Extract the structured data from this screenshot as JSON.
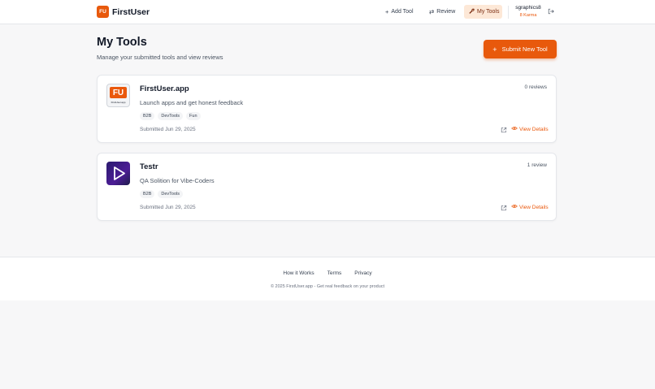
{
  "header": {
    "logo_text": "FU",
    "brand": "FirstUser",
    "nav": {
      "add_tool": "Add Tool",
      "review": "Review",
      "my_tools": "My Tools"
    },
    "user": {
      "name": "sgraphics8",
      "karma": "8 Karma"
    }
  },
  "page": {
    "title": "My Tools",
    "subtitle": "Manage your submitted tools and view reviews",
    "submit_button": "Submit New Tool"
  },
  "tools": [
    {
      "name": "FirstUser.app",
      "description": "Launch apps and get honest feedback",
      "tags": [
        "B2B",
        "DevTools",
        "Fun"
      ],
      "submitted": "Submitted Jun 29, 2025",
      "reviews": "0 reviews",
      "view_details": "View Details",
      "thumb_mark": "FU",
      "thumb_caption": "FirstUser.app"
    },
    {
      "name": "Testr",
      "description": "QA Solition for Vibe-Coders",
      "tags": [
        "B2B",
        "DevTools"
      ],
      "submitted": "Submitted Jun 29, 2025",
      "reviews": "1 review",
      "view_details": "View Details",
      "thumb_icon": "play-icon"
    }
  ],
  "footer": {
    "links": [
      "How it Works",
      "Terms",
      "Privacy"
    ],
    "copyright": "© 2025 FirstUser.app - Get real feedback on your product"
  },
  "colors": {
    "accent": "#e8590c",
    "active_nav_bg": "#fde8d7",
    "testr_thumb": "#4c1d95"
  }
}
